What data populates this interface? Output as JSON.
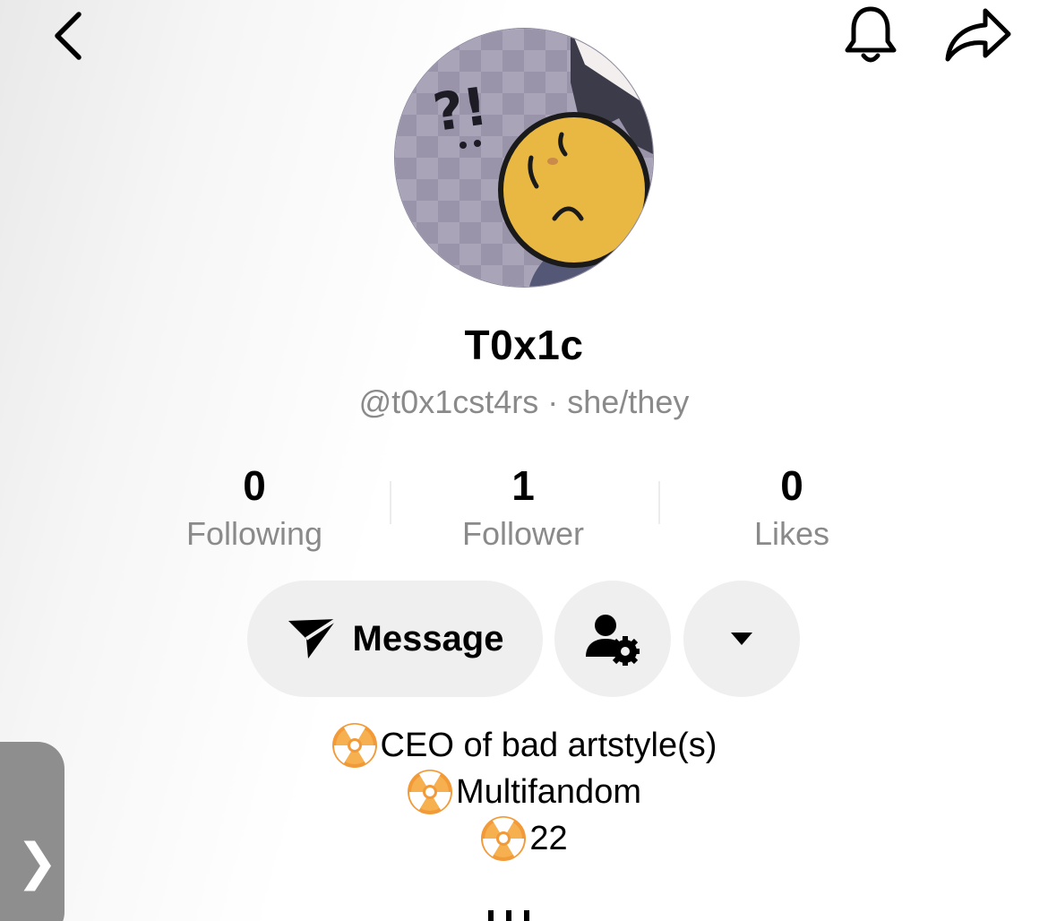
{
  "header": {
    "back_icon": "chevron-left-icon",
    "notification_icon": "bell-icon",
    "share_icon": "share-arrow-icon"
  },
  "profile": {
    "display_name": "T0x1c",
    "handle": "@t0x1cst4rs",
    "separator": "·",
    "pronouns": "she/they"
  },
  "stats": [
    {
      "value": "0",
      "label": "Following"
    },
    {
      "value": "1",
      "label": "Follower"
    },
    {
      "value": "0",
      "label": "Likes"
    }
  ],
  "actions": {
    "message_label": "Message",
    "message_icon": "send-icon",
    "profile_settings_icon": "person-gear-icon",
    "more_icon": "caret-down-icon"
  },
  "bio": {
    "icon": "radioactive-emoji",
    "lines": [
      "CEO of bad artstyle(s)",
      "Multifandom",
      "22"
    ]
  },
  "side_tab": {
    "chevron": "❯"
  },
  "colors": {
    "text_primary": "#000000",
    "text_secondary": "#8a8a8a",
    "button_bg": "#efefef",
    "radioactive_orange": "#f29a38",
    "side_tab_bg": "#8e8e8e"
  }
}
